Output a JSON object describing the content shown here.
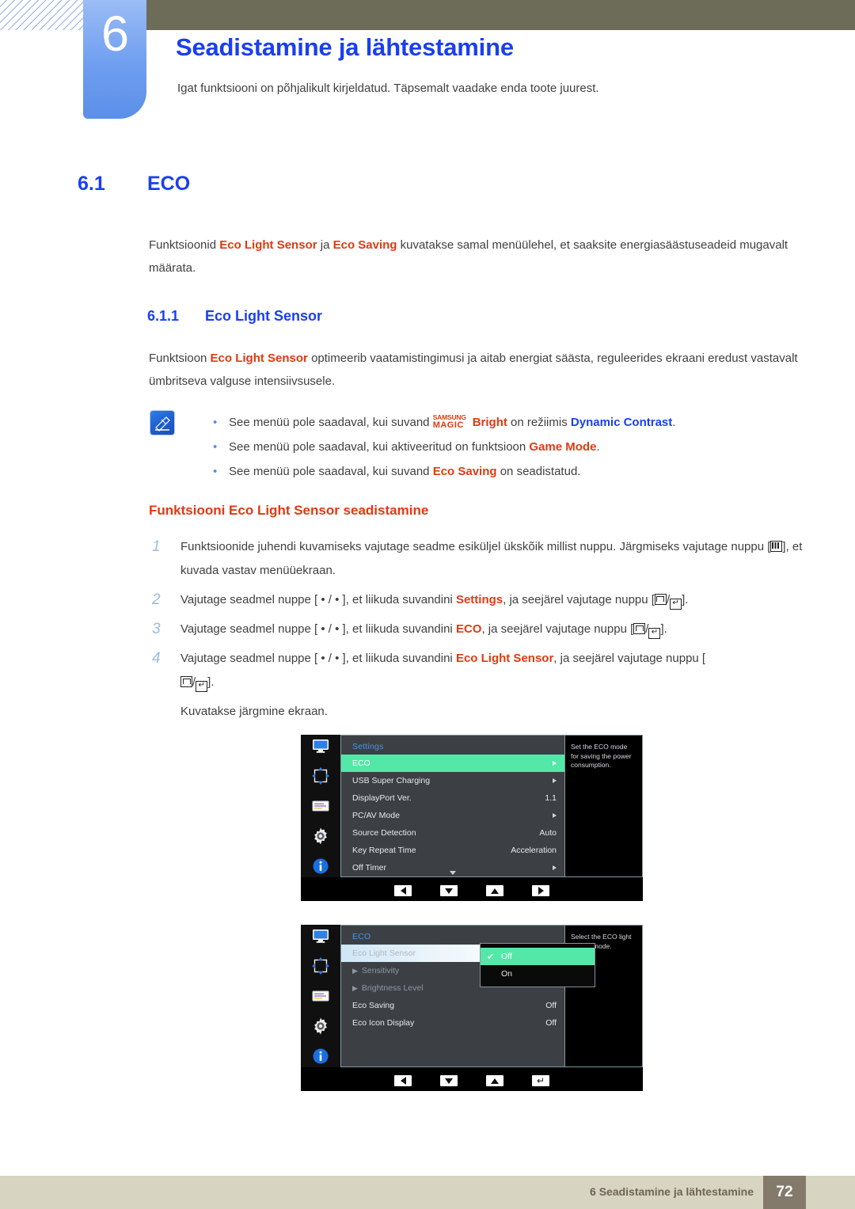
{
  "header": {
    "chapter_number": "6",
    "title": "Seadistamine ja lähtestamine",
    "subtitle": "Igat funktsiooni on põhjalikult kirjeldatud. Täpsemalt vaadake enda toote juurest."
  },
  "section": {
    "number": "6.1",
    "title": "ECO",
    "intro_1": "Funktsioonid ",
    "intro_t1": "Eco Light Sensor",
    "intro_2": " ja ",
    "intro_t2": "Eco Saving",
    "intro_3": " kuvatakse samal menüülehel, et saaksite energiasäästuseadeid mugavalt määrata."
  },
  "subsection": {
    "number": "6.1.1",
    "title": "Eco Light Sensor",
    "para_1": "Funktsioon ",
    "para_t1": "Eco Light Sensor",
    "para_2": " optimeerib vaatamistingimusi ja aitab energiat säästa, reguleerides ekraani eredust vastavalt ümbritseva valguse intensiivsusele."
  },
  "notes": {
    "icon_name": "note-pencil-icon",
    "items": [
      {
        "pre": "See menüü pole saadaval, kui suvand ",
        "magic_top": "SAMSUNG",
        "magic_bottom": "MAGIC",
        "magic_suffix": "Bright",
        "mid": " on režiimis ",
        "term": "Dynamic Contrast",
        "post": "."
      },
      {
        "pre": "See menüü pole saadaval, kui aktiveeritud on funktsioon ",
        "term": "Game Mode",
        "post": "."
      },
      {
        "pre": "See menüü pole saadaval, kui suvand ",
        "term": "Eco Saving",
        "post": " on seadistatud."
      }
    ]
  },
  "procedure": {
    "title": "Funktsiooni Eco Light Sensor seadistamine",
    "steps": [
      {
        "num": "1",
        "a": "Funktsioonide juhendi kuvamiseks vajutage seadme esiküljel ükskõik millist nuppu. Järgmiseks vajutage nuppu [",
        "b": "], et kuvada vastav menüüekraan."
      },
      {
        "num": "2",
        "a": "Vajutage seadmel nuppe [ • / • ], et liikuda suvandini ",
        "term": "Settings",
        "b": ", ja seejärel vajutage nuppu [",
        "c": "]."
      },
      {
        "num": "3",
        "a": "Vajutage seadmel nuppe [ • / • ], et liikuda suvandini ",
        "term": "ECO",
        "b": ", ja seejärel vajutage nuppu [",
        "c": "]."
      },
      {
        "num": "4",
        "a": "Vajutage seadmel nuppe [ • / • ], et liikuda suvandini ",
        "term": "Eco Light Sensor",
        "b": ", ja seejärel vajutage nuppu [",
        "c": "]."
      }
    ],
    "after_note": "Kuvatakse järgmine ekraan."
  },
  "osd_1": {
    "title": "Settings",
    "rail_icons": [
      "monitor-icon",
      "picture-position-icon",
      "onscreen-display-icon",
      "system-gear-icon",
      "information-icon"
    ],
    "rows": [
      {
        "label": "ECO",
        "value": "",
        "arrow": true,
        "selected": true
      },
      {
        "label": "USB Super Charging",
        "value": "",
        "arrow": true,
        "selected": false
      },
      {
        "label": "DisplayPort Ver.",
        "value": "1.1",
        "arrow": false,
        "selected": false
      },
      {
        "label": "PC/AV Mode",
        "value": "",
        "arrow": true,
        "selected": false
      },
      {
        "label": "Source Detection",
        "value": "Auto",
        "arrow": false,
        "selected": false
      },
      {
        "label": "Key Repeat Time",
        "value": "Acceleration",
        "arrow": false,
        "selected": false
      },
      {
        "label": "Off Timer",
        "value": "",
        "arrow": true,
        "selected": false
      }
    ],
    "help": "Set the ECO mode for saving the power consumption.",
    "buttons": [
      "left-arrow-key",
      "down-arrow-key",
      "up-arrow-key",
      "right-arrow-key"
    ]
  },
  "osd_2": {
    "title": "ECO",
    "rail_icons": [
      "monitor-icon",
      "picture-position-icon",
      "onscreen-display-icon",
      "system-gear-icon",
      "information-icon"
    ],
    "rows": [
      {
        "label": "Eco Light Sensor",
        "value": "",
        "style": "highlight"
      },
      {
        "label": "Sensitivity",
        "value": "",
        "style": "submenu"
      },
      {
        "label": "Brightness Level",
        "value": "",
        "style": "submenu"
      },
      {
        "label": "Eco Saving",
        "value": "Off",
        "style": "normal"
      },
      {
        "label": "Eco Icon Display",
        "value": "Off",
        "style": "normal"
      }
    ],
    "dropdown": {
      "options": [
        {
          "label": "Off",
          "checked": true
        },
        {
          "label": "On",
          "checked": false
        }
      ],
      "check_glyph": "✔"
    },
    "help": "Select the ECO light sensor mode.",
    "buttons": [
      "left-arrow-key",
      "down-arrow-key",
      "up-arrow-key",
      "enter-key"
    ]
  },
  "footer": {
    "text": "6 Seadistamine ja lähtestamine",
    "page": "72"
  },
  "colors": {
    "accent_blue": "#1a3ff0",
    "accent_red": "#e03a10",
    "khaki": "#6d6c58",
    "footer_bg": "#d8d4c2",
    "page_chip": "#847a6c",
    "osd_select_green": "#53e8a8",
    "tab_blue": "#6f9ef0"
  }
}
